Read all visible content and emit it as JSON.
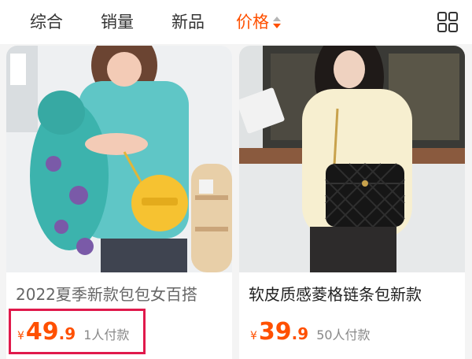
{
  "sort_bar": {
    "tabs": [
      {
        "label": "综合"
      },
      {
        "label": "销量"
      },
      {
        "label": "新品"
      },
      {
        "label": "价格"
      }
    ],
    "active_tab": "价格",
    "grid_toggle_icon": "grid-view-icon"
  },
  "products": [
    {
      "title": "2022夏季新款包包女百搭",
      "currency": "¥",
      "price_int": "49",
      "price_dec": ".9",
      "sales": "1人付款"
    },
    {
      "title": "软皮质感菱格链条包新款",
      "currency": "¥",
      "price_int": "39",
      "price_dec": ".9",
      "sales": "50人付款"
    }
  ],
  "colors": {
    "accent": "#ff5000",
    "highlight": "#e0194b"
  }
}
